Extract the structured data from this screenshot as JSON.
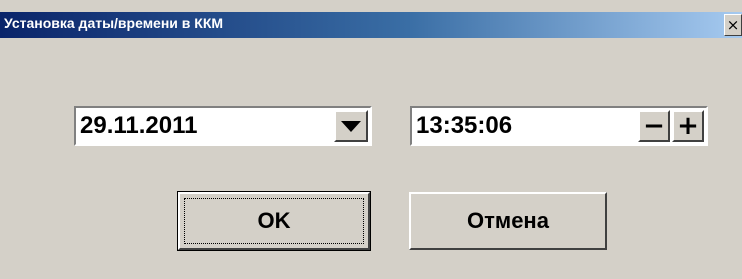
{
  "window": {
    "title": "Установка даты/времени в ККМ",
    "close_label": "×"
  },
  "date_picker": {
    "value": "29.11.2011",
    "dropdown_icon": "chevron-down-icon"
  },
  "time_field": {
    "value": "13:35:06",
    "minus_label": "−",
    "plus_label": "+"
  },
  "buttons": {
    "ok_label": "OK",
    "cancel_label": "Отмена"
  }
}
